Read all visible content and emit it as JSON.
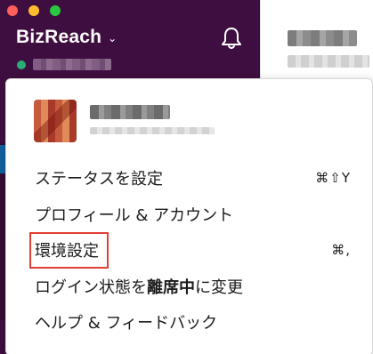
{
  "window": {
    "traffic_lights": [
      "close",
      "minimize",
      "zoom"
    ]
  },
  "sidebar": {
    "workspace_name": "BizReach",
    "workspace_chevron": "⌄",
    "status_color": "#2bac76",
    "notifications_icon": "bell-icon",
    "background_color": "#3f0e40"
  },
  "menu": {
    "items": [
      {
        "label": "ステータスを設定",
        "shortcut": "⌘⇧Y"
      },
      {
        "label": "プロフィール & アカウント",
        "shortcut": ""
      },
      {
        "label": "環境設定",
        "shortcut": "⌘,"
      },
      {
        "label_before": "ログイン状態を",
        "label_bold": "離席中",
        "label_after": "に変更",
        "shortcut": ""
      },
      {
        "label": "ヘルプ & フィードバック",
        "shortcut": ""
      }
    ],
    "highlight_color": "#e04035"
  }
}
